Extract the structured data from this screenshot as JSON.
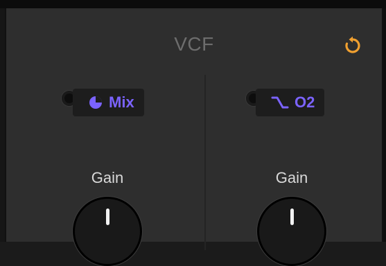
{
  "module": {
    "title": "VCF"
  },
  "left_column": {
    "mod_source_label": "Mix",
    "mod_source_icon": "pie-chart-icon",
    "gain_label": "Gain",
    "gain_value_fraction": 0.5
  },
  "right_column": {
    "mod_source_label": "O2",
    "mod_source_icon": "wave-ramp-icon",
    "gain_label": "Gain",
    "gain_value_fraction": 0.5
  },
  "colors": {
    "accent": "#7b63ff",
    "reset": "#f0a030",
    "panel": "#2e2e2e"
  }
}
